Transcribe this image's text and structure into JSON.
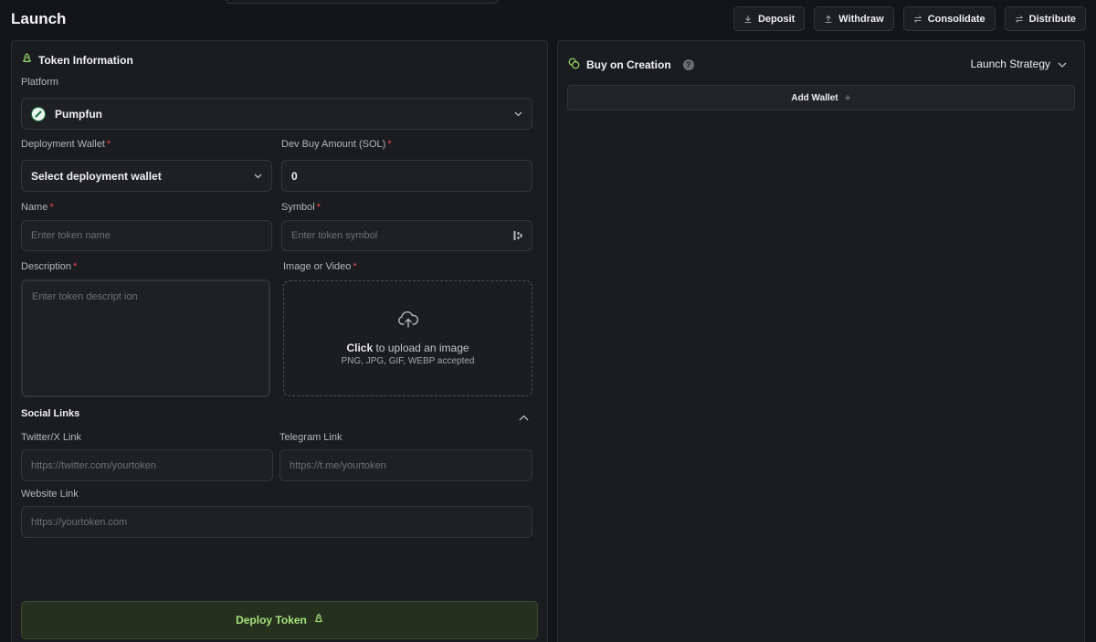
{
  "header": {
    "title": "Launch",
    "actions": [
      {
        "label": "Deposit",
        "icon": "download-icon"
      },
      {
        "label": "Withdraw",
        "icon": "upload-icon"
      },
      {
        "label": "Consolidate",
        "icon": "arrows-exchange-icon"
      },
      {
        "label": "Distribute",
        "icon": "arrows-exchange-icon"
      }
    ]
  },
  "token_info": {
    "title": "Token Information",
    "platform": {
      "label": "Platform",
      "value": "Pumpfun"
    },
    "deployment_wallet": {
      "label": "Deployment Wallet",
      "required": "*",
      "value": "Select deployment wallet"
    },
    "dev_buy": {
      "label": "Dev Buy Amount (SOL)",
      "required": "*",
      "value": "0"
    },
    "name": {
      "label": "Name",
      "required": "*",
      "placeholder": "Enter token name"
    },
    "symbol": {
      "label": "Symbol",
      "required": "*",
      "placeholder": "Enter token symbol"
    },
    "description": {
      "label": "Description",
      "required": "*",
      "placeholder": "Enter token descript ion"
    },
    "media": {
      "label": "Image or Video",
      "required": "*",
      "click_text": "Click",
      "upload_text": " to upload an image",
      "formats": "PNG, JPG, GIF, WEBP accepted"
    },
    "social": {
      "title": "Social Links",
      "twitter": {
        "label": "Twitter/X Link",
        "placeholder": "https://twitter.com/yourtoken"
      },
      "telegram": {
        "label": "Telegram Link",
        "placeholder": "https://t.me/yourtoken"
      },
      "website": {
        "label": "Website Link",
        "placeholder": "https://yourtoken.com"
      }
    },
    "deploy_label": "Deploy Token"
  },
  "buy_on_creation": {
    "title": "Buy on Creation",
    "help": "?",
    "strategy_label": "Launch Strategy",
    "add_wallet_label": "Add Wallet",
    "add_icon": "+"
  },
  "colors": {
    "accent_green": "#a6e37a",
    "required_red": "#e5484d",
    "background": "#141517",
    "panel": "#1b1c1f"
  }
}
